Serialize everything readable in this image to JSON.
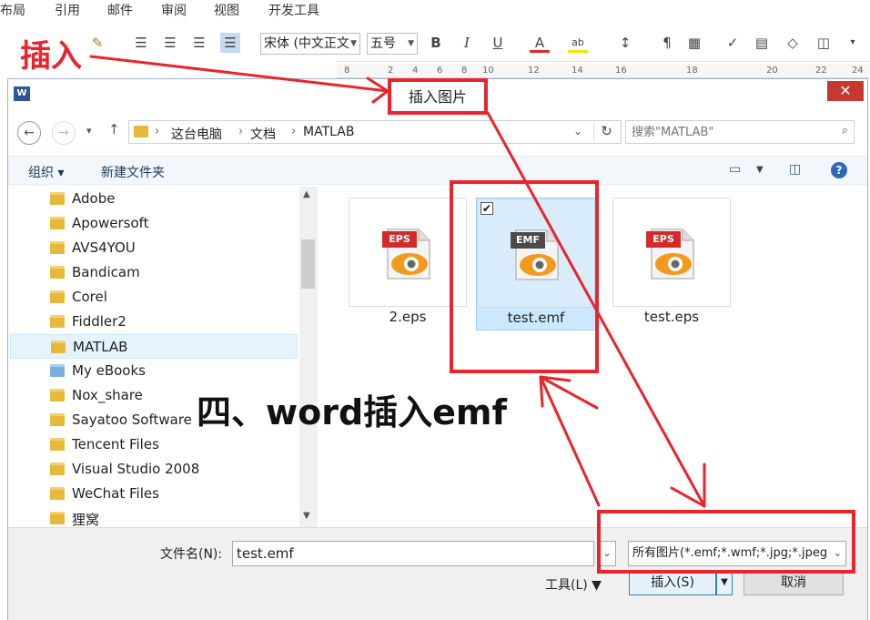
{
  "ribbon": {
    "tabs": [
      "布局",
      "引用",
      "邮件",
      "审阅",
      "视图",
      "开发工具"
    ],
    "font_name": "宋体 (中文正文",
    "font_size": "五号",
    "ruler_ticks": [
      "8",
      "2",
      "4",
      "6",
      "8",
      "10",
      "12",
      "14",
      "16",
      "18",
      "20",
      "22",
      "24"
    ]
  },
  "dialog": {
    "app_icon": "W",
    "title": "插入图片",
    "close": "✕",
    "breadcrumb": [
      "这台电脑",
      "文档",
      "MATLAB"
    ],
    "search_placeholder": "搜索\"MATLAB\"",
    "toolbar": {
      "organize": "组织 ▾",
      "new_folder": "新建文件夹"
    },
    "tree": [
      {
        "label": "Adobe",
        "icon": "folder-icon"
      },
      {
        "label": "Apowersoft",
        "icon": "folder-icon"
      },
      {
        "label": "AVS4YOU",
        "icon": "folder-icon"
      },
      {
        "label": "Bandicam",
        "icon": "folder-icon"
      },
      {
        "label": "Corel",
        "icon": "folder-icon"
      },
      {
        "label": "Fiddler2",
        "icon": "folder-icon"
      },
      {
        "label": "MATLAB",
        "icon": "folder-icon",
        "selected": true
      },
      {
        "label": "My eBooks",
        "icon": "special-folder-icon"
      },
      {
        "label": "Nox_share",
        "icon": "folder-icon"
      },
      {
        "label": "Sayatoo Software",
        "icon": "folder-icon"
      },
      {
        "label": "Tencent Files",
        "icon": "folder-icon"
      },
      {
        "label": "Visual Studio 2008",
        "icon": "folder-icon"
      },
      {
        "label": "WeChat Files",
        "icon": "folder-icon"
      },
      {
        "label": "狸窝",
        "icon": "folder-icon"
      }
    ],
    "files": [
      {
        "name": "2.eps",
        "badge": "EPS",
        "badge_color": "#d42a2a",
        "selected": false
      },
      {
        "name": "test.emf",
        "badge": "EMF",
        "badge_color": "#4a4a4a",
        "selected": true
      },
      {
        "name": "test.eps",
        "badge": "EPS",
        "badge_color": "#d42a2a",
        "selected": false
      }
    ],
    "filename_label": "文件名(N):",
    "filename_value": "test.emf",
    "filter_value": "所有图片(*.emf;*.wmf;*.jpg;*.jpeg",
    "tools_label": "工具(L)",
    "insert_label": "插入(S)",
    "cancel_label": "取消"
  },
  "annotations": {
    "insert_text": "插入",
    "caption": "四、word插入emf",
    "color": "#e8242c"
  }
}
